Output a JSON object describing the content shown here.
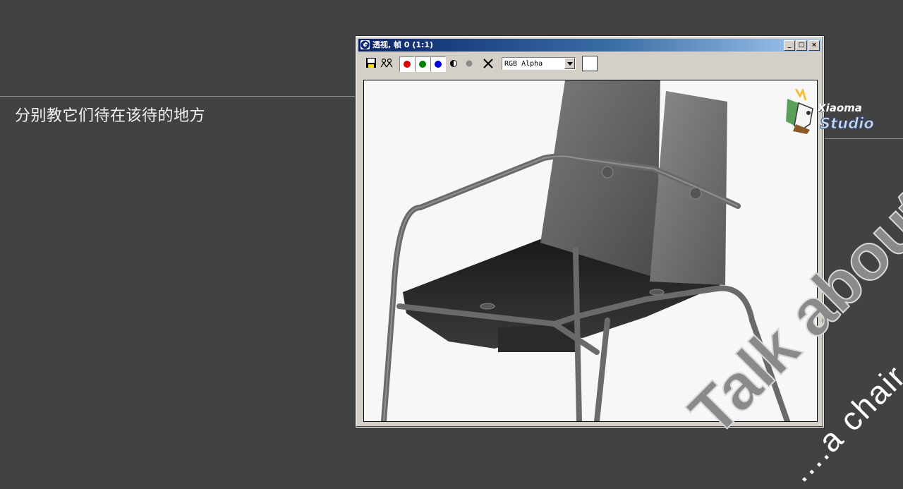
{
  "slide": {
    "subtitle": "分别教它们待在该待的地方"
  },
  "window": {
    "title": "透视, 帧 0 (1:1)",
    "title_icon": "max-logo-icon",
    "controls": {
      "minimize": "_",
      "maximize": "□",
      "close": "×"
    }
  },
  "toolbar": {
    "save_icon": "save-icon",
    "clone_icon": "clone-frame-icon",
    "channels": [
      {
        "name": "red-channel",
        "color": "#e00000"
      },
      {
        "name": "green-channel",
        "color": "#008000"
      },
      {
        "name": "blue-channel",
        "color": "#0000e0"
      }
    ],
    "channel_mode": "RGB Alpha",
    "swatch_color": "#ffffff"
  },
  "logo": {
    "name": "Xiaoma",
    "subname": "Studio"
  },
  "watermark": {
    "main": "Talk about",
    "sub": "....a chair"
  },
  "colors": {
    "background": "#424242",
    "viewport": "#f7f7f7",
    "chair": "#6e6e6e"
  }
}
